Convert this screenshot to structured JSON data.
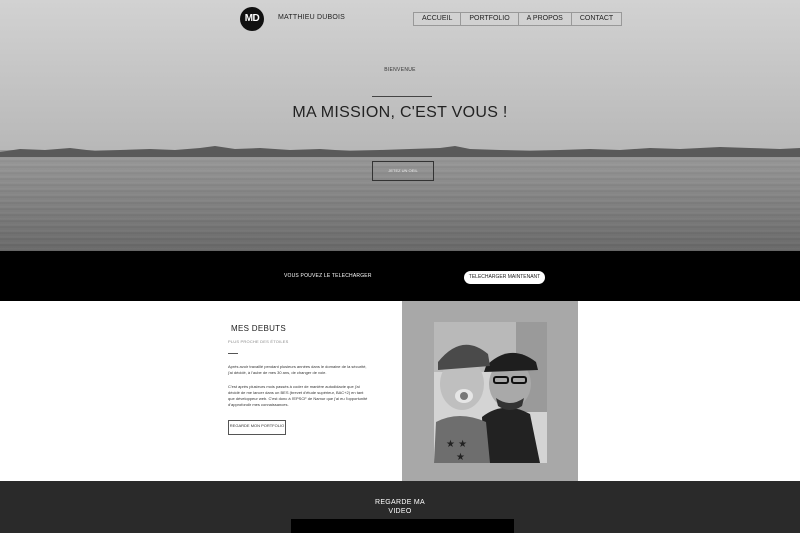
{
  "header": {
    "logo_text": "MD",
    "brand": "MATTHIEU DUBOIS",
    "nav": [
      "ACCUEIL",
      "PORTFOLIO",
      "A PROPOS",
      "CONTACT"
    ]
  },
  "hero": {
    "welcome": "BIENVENUE",
    "title": "MA MISSION, C'EST VOUS !",
    "cta": "JETEZ UN OEIL"
  },
  "download": {
    "text": "VOUS POUVEZ LE TELECHARGER",
    "button": "TELECHARGER MAINTENANT"
  },
  "about": {
    "heading": "MES DEBUTS",
    "subheading": "PLUS PROCHE DES ÉTOILES",
    "paragraph1": "Après avoir travaillé pendant plusieurs années dans le domaine de la sécurité, j'ai décidé, à l'aube de mes 30 ans, de changer de voie.",
    "paragraph2": "C'est après plusieurs mois passés à coder de manière autodidacte que j'ai décidé de me lancer dans un BES (brevet d'étude supérieur, BAC+2) en tant que développeur web. C'est donc à l'EPSCF de Namur que j'ai eu l'opportunité d'approfondir mes connaissances.",
    "button": "REGARDE MON PORTFOLIO"
  },
  "video": {
    "title_line1": "REGARDE MA",
    "title_line2": "VIDEO"
  }
}
